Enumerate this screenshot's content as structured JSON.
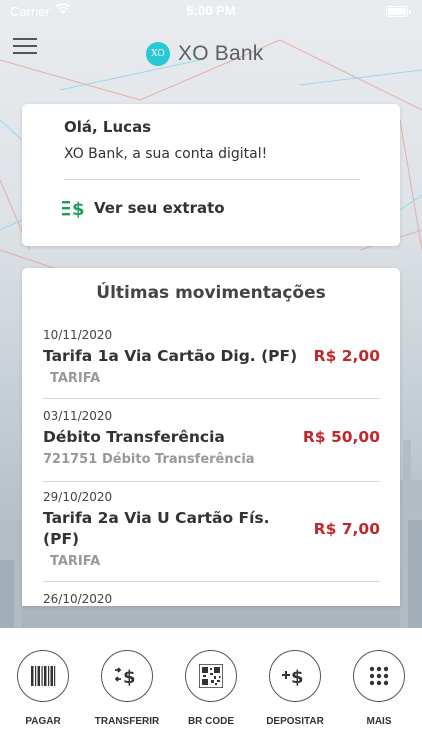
{
  "status_bar": {
    "carrier": "Carrier",
    "time": "5:00 PM"
  },
  "header": {
    "logo_text": "XO",
    "brand": "XO Bank"
  },
  "welcome": {
    "greeting": "Olá, Lucas",
    "subtitle": "XO Bank, a sua conta digital!",
    "statement_link": "Ver seu extrato"
  },
  "movements": {
    "title": "Últimas movimentações",
    "items": [
      {
        "date": "10/11/2020",
        "description": "Tarifa 1a Via Cartão Dig. (PF)",
        "amount": "R$ 2,00",
        "code": "",
        "category": "TARIFA"
      },
      {
        "date": "03/11/2020",
        "description": "Débito Transferência",
        "amount": "R$ 50,00",
        "code": "721751",
        "category": "Débito Transferência"
      },
      {
        "date": "29/10/2020",
        "description_line1": "Tarifa 2a Via U Cartão Fís.",
        "description_line2": "(PF)",
        "amount": "R$ 7,00",
        "code": "",
        "category": "TARIFA"
      },
      {
        "date": "26/10/2020"
      }
    ]
  },
  "tabbar": {
    "items": [
      {
        "label": "PAGAR",
        "icon": "barcode-icon"
      },
      {
        "label": "TRANSFERIR",
        "icon": "transfer-money-icon"
      },
      {
        "label": "BR CODE",
        "icon": "qr-code-icon"
      },
      {
        "label": "DEPOSITAR",
        "icon": "add-money-icon"
      },
      {
        "label": "MAIS",
        "icon": "more-grid-icon"
      }
    ]
  },
  "colors": {
    "accent_teal": "#27c9d4",
    "amount_red": "#c0282d",
    "extrato_green": "#1f9d55"
  }
}
